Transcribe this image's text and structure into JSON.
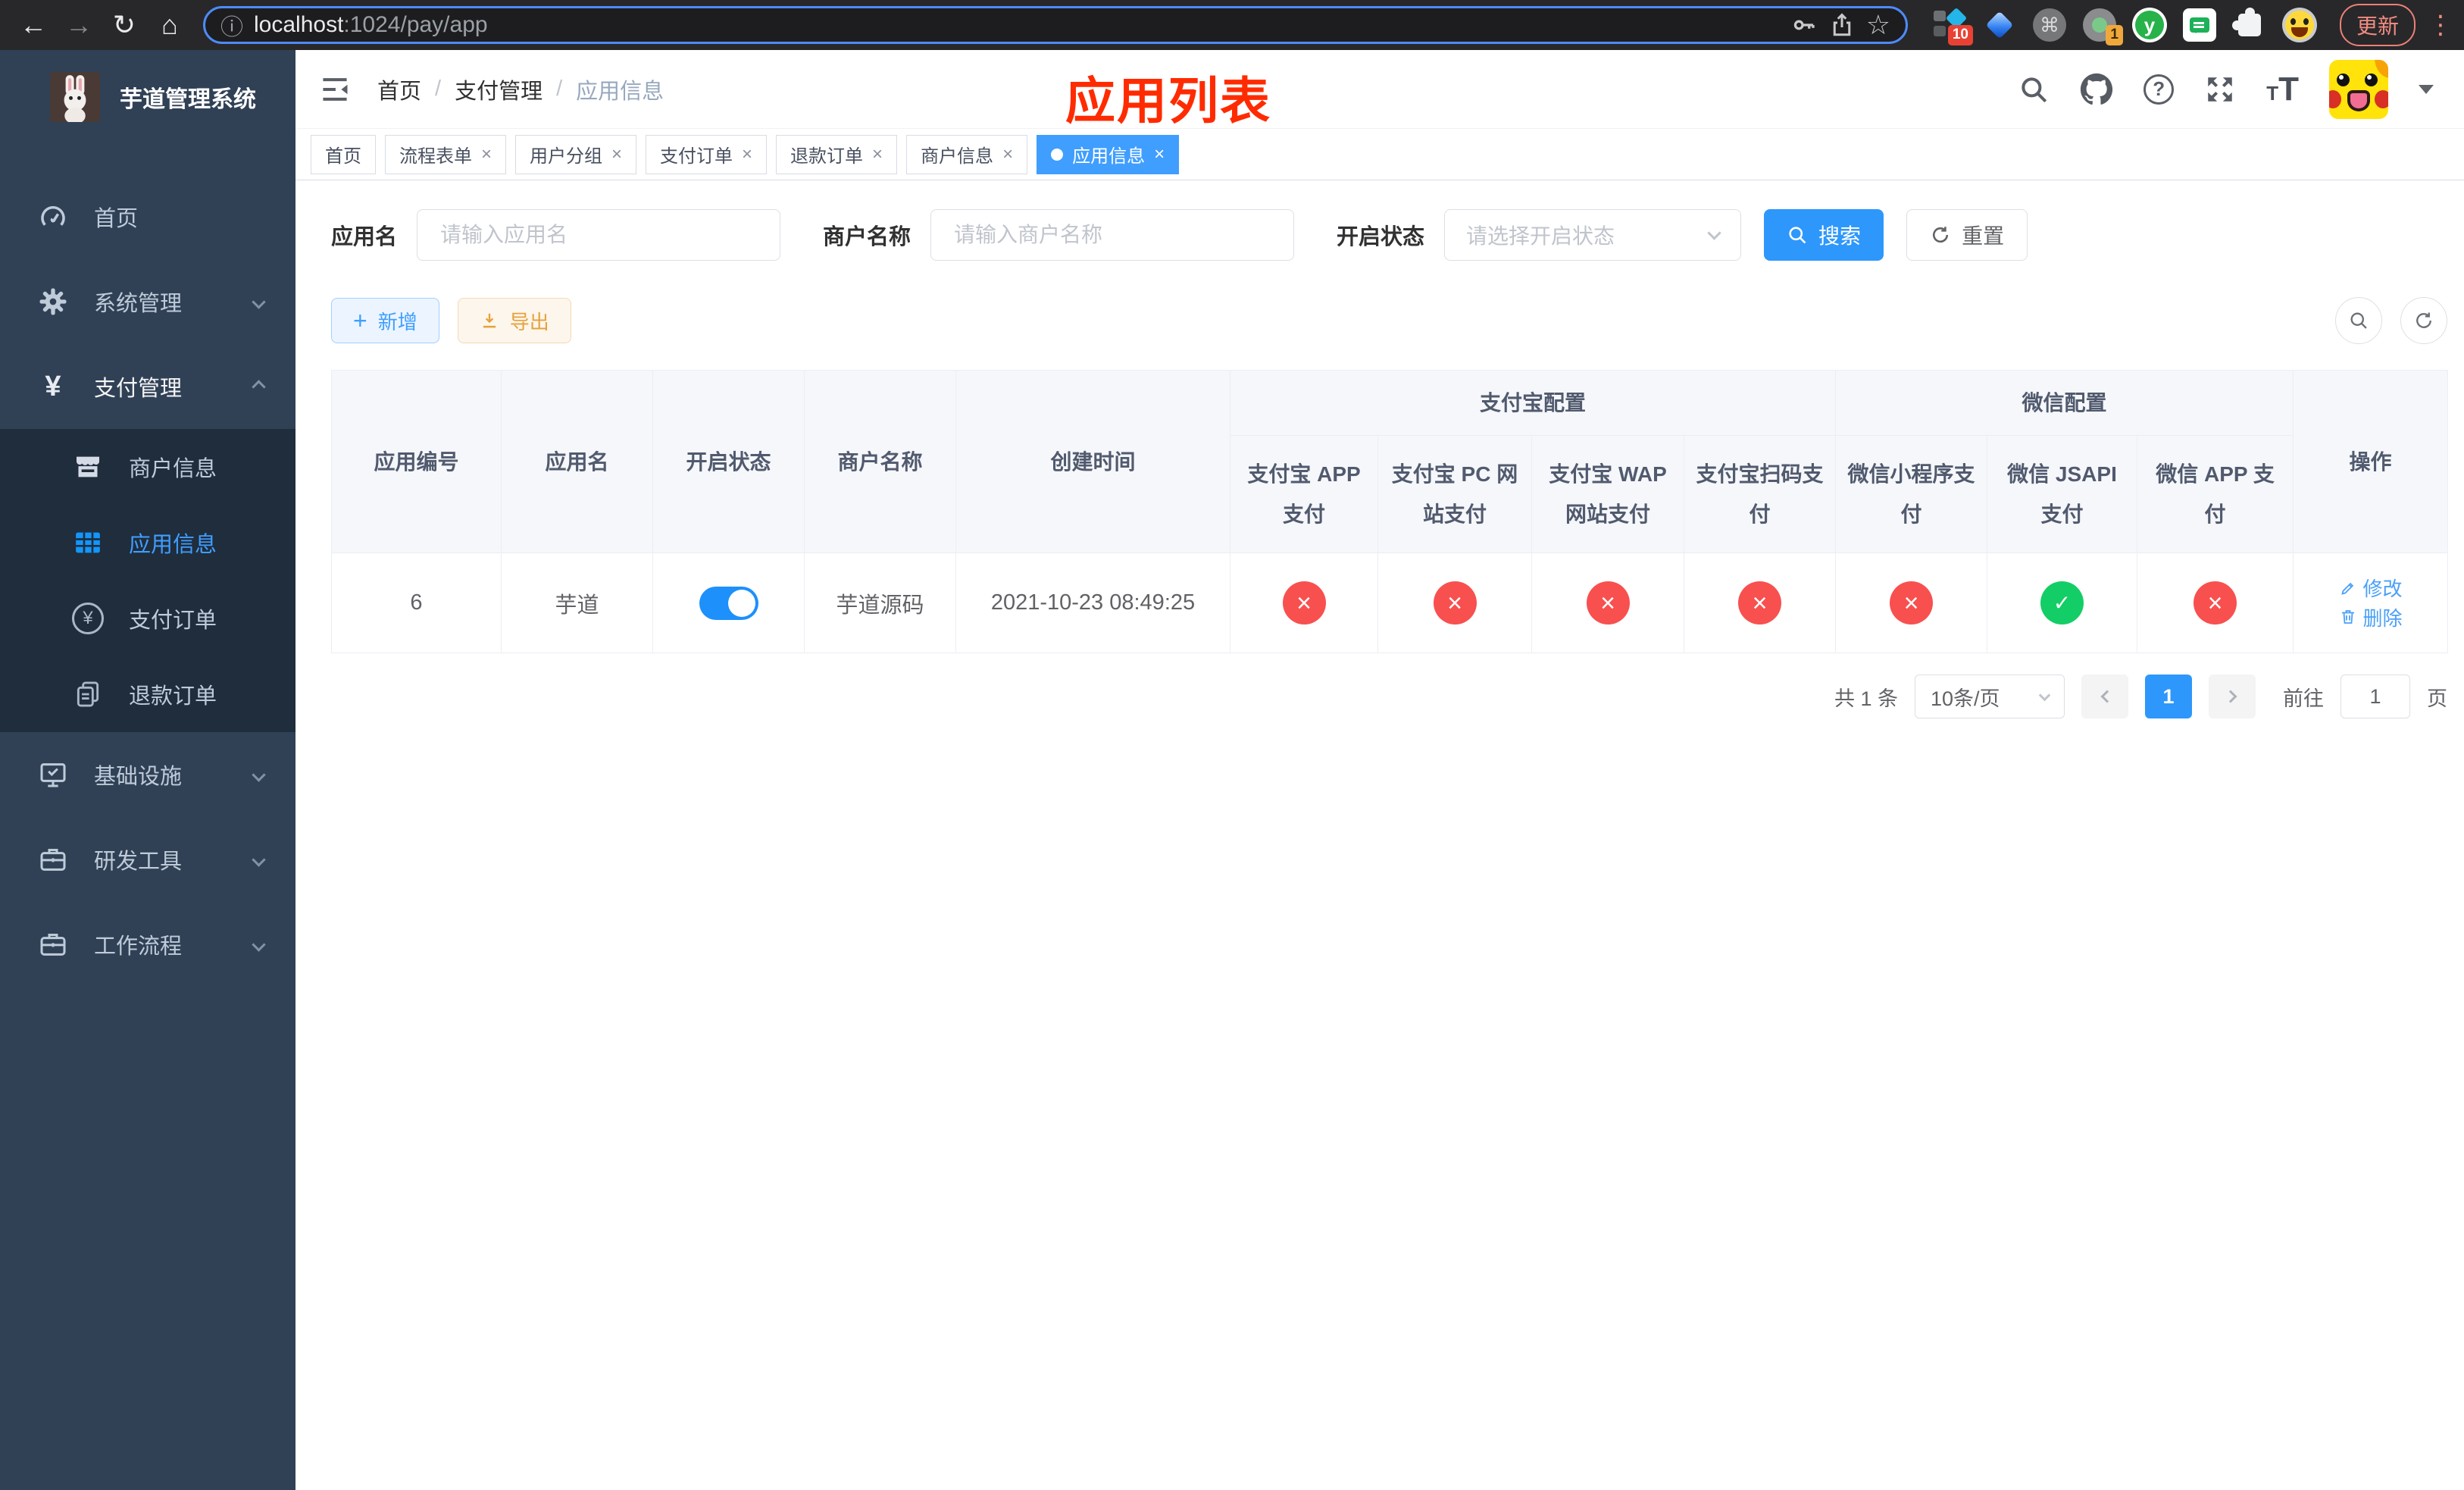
{
  "browser": {
    "url_host": "localhost",
    "url_path": ":1024/pay/app",
    "update_label": "更新",
    "badge_10": "10",
    "badge_1": "1"
  },
  "sidebar": {
    "title": "芋道管理系统",
    "items": [
      "首页",
      "系统管理",
      "支付管理",
      "商户信息",
      "应用信息",
      "支付订单",
      "退款订单",
      "基础设施",
      "研发工具",
      "工作流程"
    ]
  },
  "breadcrumb": [
    "首页",
    "支付管理",
    "应用信息"
  ],
  "page_title": "应用列表",
  "tabs": [
    "首页",
    "流程表单",
    "用户分组",
    "支付订单",
    "退款订单",
    "商户信息",
    "应用信息"
  ],
  "filter": {
    "app_name_label": "应用名",
    "app_name_placeholder": "请输入应用名",
    "merchant_label": "商户名称",
    "merchant_placeholder": "请输入商户名称",
    "status_label": "开启状态",
    "status_placeholder": "请选择开启状态",
    "search": "搜索",
    "reset": "重置"
  },
  "toolbar": {
    "add": "新增",
    "export": "导出"
  },
  "table": {
    "groups": [
      "支付宝配置",
      "微信配置"
    ],
    "columns": [
      "应用编号",
      "应用名",
      "开启状态",
      "商户名称",
      "创建时间",
      "支付宝 APP 支付",
      "支付宝 PC 网站支付",
      "支付宝 WAP 网站支付",
      "支付宝扫码支付",
      "微信小程序支付",
      "微信 JSAPI 支付",
      "微信 APP 支付",
      "操作"
    ],
    "row": {
      "app_id": "6",
      "app_name": "芋道",
      "switch_state": "on",
      "merchant": "芋道源码",
      "created": "2021-10-23 08:49:25",
      "channels": [
        "no",
        "no",
        "no",
        "no",
        "no",
        "ok",
        "no"
      ],
      "edit": "修改",
      "delete": "删除"
    }
  },
  "pagination": {
    "total": "共 1 条",
    "page_size": "10条/页",
    "page": "1",
    "goto": "前往",
    "page_unit": "页",
    "goto_value": "1"
  },
  "colors": {
    "accent": "#409eff",
    "danger": "#f56c6c",
    "success": "#13ce66",
    "warning": "#e6a23c",
    "title_red": "#ff2b00"
  }
}
